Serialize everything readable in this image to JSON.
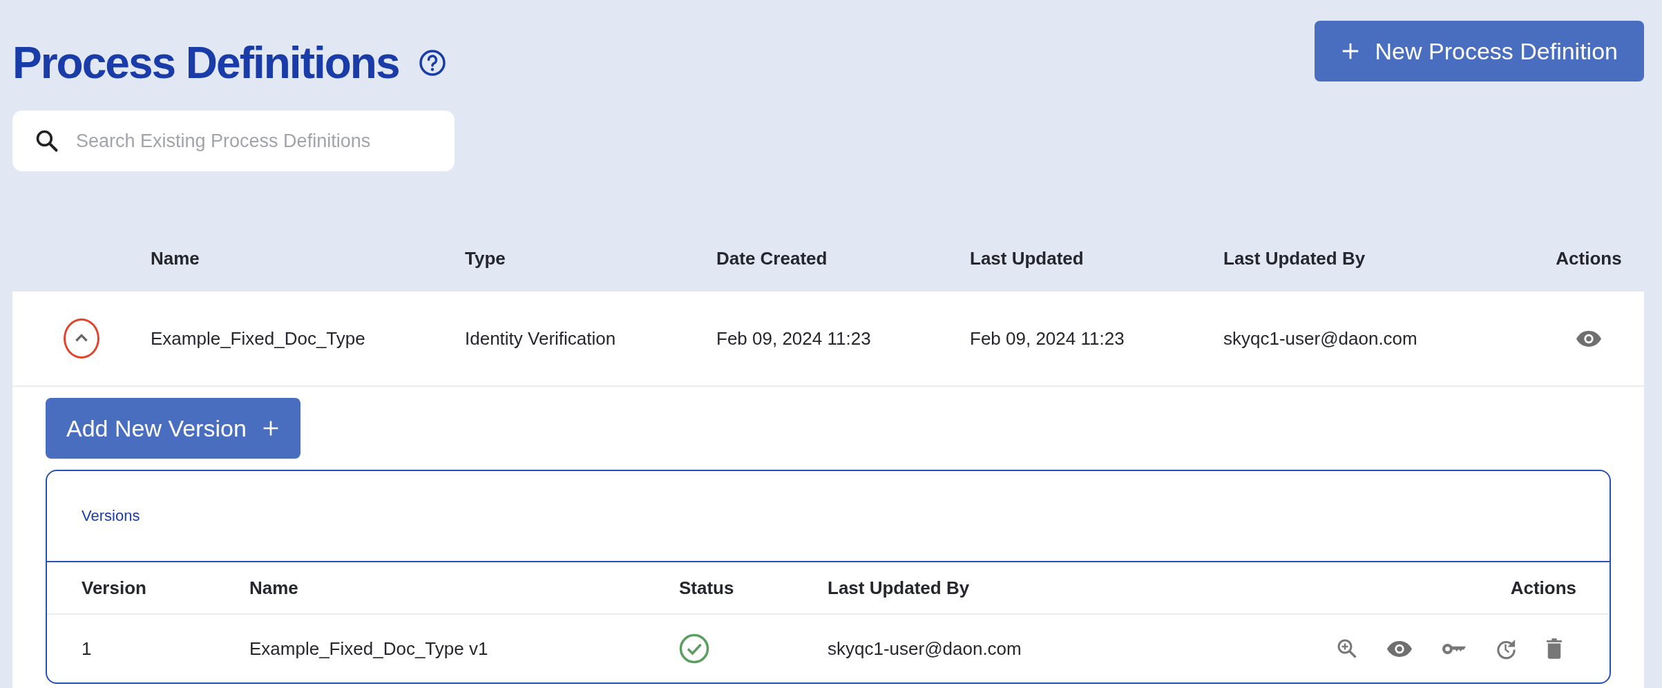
{
  "page": {
    "title": "Process Definitions",
    "new_button": "New Process Definition"
  },
  "search": {
    "placeholder": "Search Existing Process Definitions"
  },
  "table": {
    "columns": [
      "Name",
      "Type",
      "Date Created",
      "Last Updated",
      "Last Updated By",
      "Actions"
    ],
    "rows": [
      {
        "expanded": true,
        "name": "Example_Fixed_Doc_Type",
        "type": "Identity Verification",
        "date_created": "Feb 09, 2024 11:23",
        "last_updated": "Feb 09, 2024 11:23",
        "last_updated_by": "skyqc1-user@daon.com",
        "add_button": "Add New Version",
        "versions": {
          "title": "Versions",
          "columns": [
            "Version",
            "Name",
            "Status",
            "Last Updated By",
            "Actions"
          ],
          "rows": [
            {
              "version": "1",
              "name": "Example_Fixed_Doc_Type v1",
              "status_ok": true,
              "last_updated_by": "skyqc1-user@daon.com"
            }
          ]
        }
      }
    ]
  }
}
